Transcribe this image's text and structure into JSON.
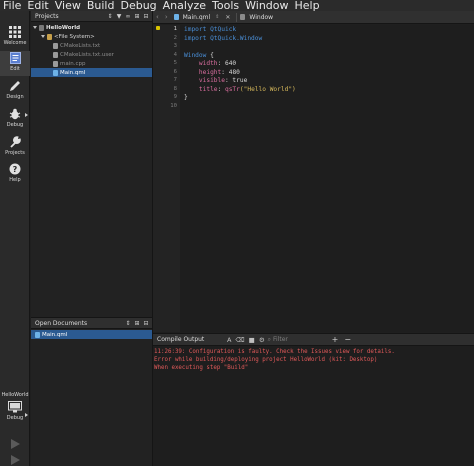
{
  "menubar": {
    "items": [
      "File",
      "Edit",
      "View",
      "Build",
      "Debug",
      "Analyze",
      "Tools",
      "Window",
      "Help"
    ]
  },
  "modes": [
    {
      "name": "welcome",
      "label": "Welcome",
      "icon": "grid-icon",
      "active": false
    },
    {
      "name": "edit",
      "label": "Edit",
      "icon": "document-icon",
      "active": true
    },
    {
      "name": "design",
      "label": "Design",
      "icon": "pen-icon",
      "active": false
    },
    {
      "name": "debug",
      "label": "Debug",
      "icon": "bug-icon",
      "active": false
    },
    {
      "name": "projects",
      "label": "Projects",
      "icon": "wrench-icon",
      "active": false
    },
    {
      "name": "help",
      "label": "Help",
      "icon": "question-icon",
      "active": false
    }
  ],
  "kit_selector": {
    "project": "HelloWorld",
    "config": "Debug"
  },
  "projects_panel": {
    "title": "Projects",
    "tree": [
      {
        "label": "HelloWorld",
        "level": 0,
        "icon": "project-icon",
        "selected": false
      },
      {
        "label": "<File System>",
        "level": 1,
        "icon": "folder-icon",
        "selected": false
      },
      {
        "label": "CMakeLists.txt",
        "level": 2,
        "icon": "file-icon",
        "selected": false,
        "dim": true
      },
      {
        "label": "CMakeLists.txt.user",
        "level": 2,
        "icon": "file-icon",
        "selected": false,
        "dim": true
      },
      {
        "label": "main.cpp",
        "level": 2,
        "icon": "file-icon",
        "selected": false,
        "dim": true
      },
      {
        "label": "Main.qml",
        "level": 2,
        "icon": "qml-file-icon",
        "selected": true,
        "dim": false
      }
    ]
  },
  "open_documents": {
    "title": "Open Documents",
    "items": [
      {
        "label": "Main.qml",
        "selected": true
      }
    ]
  },
  "editor": {
    "file": "Main.qml",
    "window_label": "Window",
    "current_line": 1,
    "lines": [
      [
        {
          "t": "import",
          "c": "kw"
        },
        {
          "t": " QtQuick",
          "c": "kw"
        }
      ],
      [
        {
          "t": "import",
          "c": "kw"
        },
        {
          "t": " QtQuick.Window",
          "c": "kw"
        }
      ],
      [],
      [
        {
          "t": "Window",
          "c": "kw"
        },
        {
          "t": " {",
          "c": "plain"
        }
      ],
      [
        {
          "t": "    width",
          "c": "prop"
        },
        {
          "t": ": 640",
          "c": "val"
        }
      ],
      [
        {
          "t": "    height",
          "c": "prop"
        },
        {
          "t": ": 480",
          "c": "val"
        }
      ],
      [
        {
          "t": "    visible",
          "c": "prop"
        },
        {
          "t": ": true",
          "c": "val"
        }
      ],
      [
        {
          "t": "    title",
          "c": "prop"
        },
        {
          "t": ": ",
          "c": "val"
        },
        {
          "t": "qsTr",
          "c": "fn"
        },
        {
          "t": "(\"Hello World\")",
          "c": "str"
        }
      ],
      [
        {
          "t": "}",
          "c": "plain"
        }
      ],
      []
    ]
  },
  "output": {
    "tab": "Compile Output",
    "filter_placeholder": "Filter",
    "lines": [
      "11:26:39: Configuration is faulty. Check the Issues view for details.",
      "Error while building/deploying project HelloWorld (kit: Desktop)",
      "When executing step \"Build\""
    ]
  },
  "colors": {
    "accent": "#2b5a91",
    "error_text": "#e25a5a",
    "keyword": "#4a8fd8",
    "property": "#d96d9e",
    "string": "#d7b95b"
  }
}
